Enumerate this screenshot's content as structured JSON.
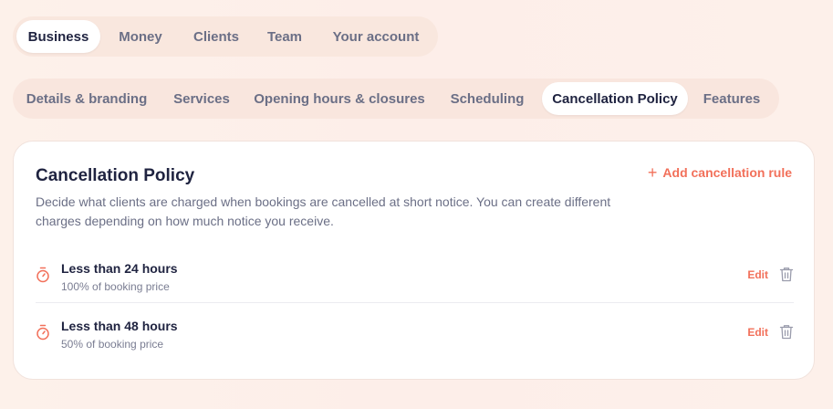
{
  "primary_tabs": [
    {
      "label": "Business",
      "active": true
    },
    {
      "label": "Money",
      "active": false
    },
    {
      "label": "Clients",
      "active": false
    },
    {
      "label": "Team",
      "active": false
    },
    {
      "label": "Your account",
      "active": false
    }
  ],
  "secondary_tabs": [
    {
      "label": "Details & branding",
      "active": false
    },
    {
      "label": "Services",
      "active": false
    },
    {
      "label": "Opening hours & closures",
      "active": false
    },
    {
      "label": "Scheduling",
      "active": false
    },
    {
      "label": "Cancellation Policy",
      "active": true
    },
    {
      "label": "Features",
      "active": false
    }
  ],
  "card": {
    "title": "Cancellation Policy",
    "description": "Decide what clients are charged when bookings are cancelled at short notice. You can create different charges depending on how much notice you receive.",
    "add_rule_label": "Add cancellation rule",
    "add_rule_icon": "plus-icon"
  },
  "rules": [
    {
      "title": "Less than 24 hours",
      "subtitle": "100% of booking price",
      "edit_label": "Edit",
      "icon": "stopwatch-icon"
    },
    {
      "title": "Less than 48 hours",
      "subtitle": "50% of booking price",
      "edit_label": "Edit",
      "icon": "stopwatch-icon"
    }
  ],
  "colors": {
    "accent": "#f2705a",
    "text_dark": "#1f2340",
    "text_muted": "#6b6f86",
    "icon_gray": "#9a9cac",
    "background": "#fdf0ea"
  }
}
